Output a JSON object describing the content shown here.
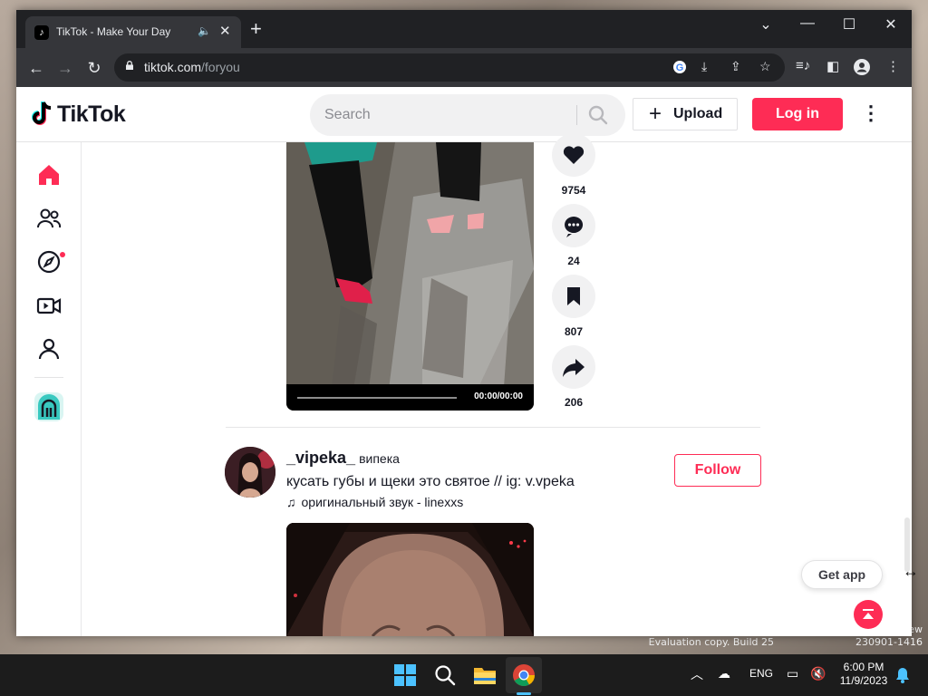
{
  "browser": {
    "tab_title": "TikTok - Make Your Day",
    "url_host": "tiktok.com",
    "url_path": "/foryou"
  },
  "tiktok": {
    "logo_text": "TikTok",
    "search_placeholder": "Search",
    "upload_label": "Upload",
    "login_label": "Log in",
    "sidebar_items": [
      "home",
      "following",
      "explore",
      "live",
      "profile"
    ]
  },
  "video1": {
    "time": "00:00/00:00",
    "likes": "9754",
    "comments": "24",
    "saves": "807",
    "shares": "206"
  },
  "post2": {
    "username": "_vipeka_",
    "nickname": "випека",
    "caption": "кусать губы и щеки это святое // ig: v.vpeka",
    "music": "оригинальный звук - linexxs",
    "follow_label": "Follow"
  },
  "floating": {
    "get_app_label": "Get app"
  },
  "desktop": {
    "watermark_line1": "Evaluation copy. Build 25",
    "watermark_line2": "230901-1416",
    "watermark_suffix": "ew"
  },
  "taskbar": {
    "language": "ENG",
    "time": "6:00 PM",
    "date": "11/9/2023"
  },
  "colors": {
    "tiktok_red": "#fe2c55",
    "chrome_dark": "#202124"
  }
}
